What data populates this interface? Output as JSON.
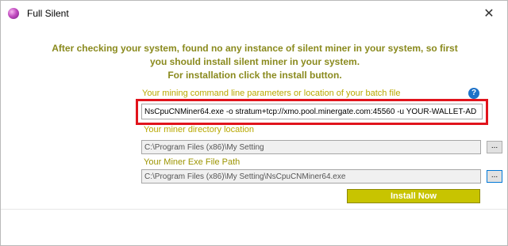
{
  "window": {
    "title": "Full Silent",
    "close_glyph": "✕",
    "app_icon": "purple-orb-icon"
  },
  "message": {
    "line1": "After checking your system, found no any instance of silent miner in your system, so first",
    "line2": "you should install silent miner in your system.",
    "line3": "For installation click the install button."
  },
  "mining_params": {
    "label": "Your mining command line parameters or location of your batch file",
    "value": "NsCpuCNMiner64.exe -o stratum+tcp://xmo.pool.minergate.com:45560 -u YOUR-WALLET-AD",
    "help_glyph": "?"
  },
  "miner_directory": {
    "label": "Your miner directory location",
    "value": "C:\\Program Files (x86)\\My Setting",
    "browse_label": "..."
  },
  "exe_path": {
    "label": "Your Miner Exe File Path",
    "value": "C:\\Program Files (x86)\\My Setting\\NsCpuCNMiner64.exe",
    "browse_label": "..."
  },
  "install_button": "Install Now",
  "colors": {
    "accent_olive": "#8a8a1e",
    "install_button": "#c8c400",
    "highlight_box": "#e1141c",
    "help_icon": "#1e72c8"
  }
}
